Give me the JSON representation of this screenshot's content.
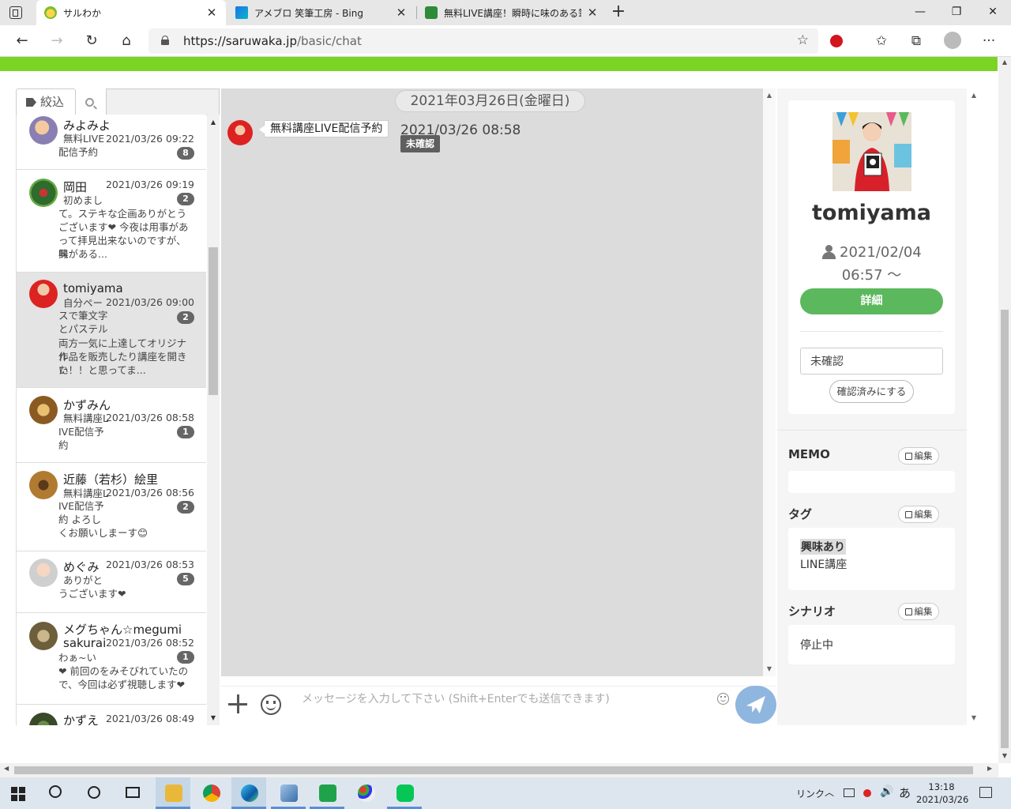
{
  "browser": {
    "tabs": [
      {
        "label": "サルわか",
        "active": true
      },
      {
        "label": "アメブロ 笑筆工房 - Bing",
        "active": false
      },
      {
        "label": "無料LIVE講座！瞬時に味のある筆文",
        "active": false
      }
    ],
    "close_glyph": "✕",
    "new_tab_glyph": "+",
    "window_controls": {
      "minimize": "—",
      "maximize": "❐",
      "close": "✕"
    },
    "nav": {
      "back": "←",
      "forward": "→",
      "reload": "↻",
      "home": "⌂"
    },
    "url_host": "https://saruwaka.jp",
    "url_path": "/basic/chat",
    "toolbar_icons": [
      "favorites-star-add-icon",
      "extension-icon",
      "favorites-icon",
      "collections-icon",
      "profile-avatar",
      "more-menu-icon"
    ],
    "more_glyph": "···"
  },
  "list": {
    "filter_label": "絞込",
    "search_placeholder": "",
    "items": [
      {
        "name": "みよみよ",
        "time": "2021/03/26 09:22",
        "badge": "8",
        "line1": "無料LIVE",
        "rest": [
          "配信予約"
        ],
        "selected": false
      },
      {
        "name": "岡田",
        "time": "2021/03/26 09:19",
        "badge": "2",
        "line1": "初めまし",
        "rest": [
          "て。ステキな企画ありがとう",
          "ございます❤ 今夜は用事があ",
          "って拝見出来ないのですが、興",
          "味がある..."
        ],
        "selected": false
      },
      {
        "name": "tomiyama",
        "time": "2021/03/26 09:00",
        "badge": "2",
        "line1": "自分ペー",
        "rest": [
          "スで筆文字",
          "とパステル",
          "両方一気に上達してオリジナル",
          "作品を販売したり講座を開きた",
          "い！！と思ってま..."
        ],
        "selected": true
      },
      {
        "name": "かずみん",
        "time": "2021/03/26 08:58",
        "badge": "1",
        "line1": "無料講座L",
        "rest": [
          "IVE配信予",
          "約"
        ],
        "selected": false
      },
      {
        "name": "近藤（若杉）絵里",
        "time": "2021/03/26 08:56",
        "badge": "2",
        "line1": "無料講座L",
        "rest": [
          "IVE配信予",
          "約 よろし",
          "くお願いしまーす😊"
        ],
        "selected": false
      },
      {
        "name": "めぐみ",
        "time": "2021/03/26 08:53",
        "badge": "5",
        "line1": "ありがと",
        "rest": [
          "うございます❤"
        ],
        "selected": false
      },
      {
        "name": "メグちゃん☆megumi",
        "name2": "sakurai",
        "time": "2021/03/26 08:52",
        "badge": "1",
        "line1": "",
        "rest": [
          "わぁ~い",
          "❤ 前回のをみそびれていたの",
          "で、今回は必ず視聴します❤"
        ],
        "selected": false
      },
      {
        "name": "かずえ",
        "time": "2021/03/26 08:49",
        "badge": "",
        "line1": "",
        "rest": [],
        "selected": false
      }
    ]
  },
  "chat": {
    "date_label": "2021年03月26日(金曜日)",
    "message_text": "無料講座LIVE配信予約",
    "message_time": "2021/03/26 08:58",
    "status_tag": "未確認",
    "input_placeholder": "メッセージを入力して下さい (Shift+Enterでも送信できます)"
  },
  "profile": {
    "name": "tomiyama",
    "registered_date": "2021/02/04",
    "registered_time": "06:57 ～",
    "detail_label": "詳細",
    "status_value": "未確認",
    "confirm_label": "確認済みにする",
    "memo_title": "MEMO",
    "memo_value": "",
    "tag_title": "タグ",
    "tags": [
      "興味あり",
      "LINE講座"
    ],
    "scenario_title": "シナリオ",
    "scenario_value": "停止中",
    "edit_label": "編集"
  },
  "colors": {
    "accent_green": "#7bd424",
    "button_green": "#5cb85c",
    "send_blue": "#8fb6de"
  },
  "taskbar": {
    "apps": [
      "explorer",
      "chrome",
      "edge",
      "app",
      "spreadsheet",
      "paint",
      "line"
    ],
    "tray_link": "リンク",
    "tray_ime": "あ",
    "time": "13:18",
    "date": "2021/03/26"
  }
}
